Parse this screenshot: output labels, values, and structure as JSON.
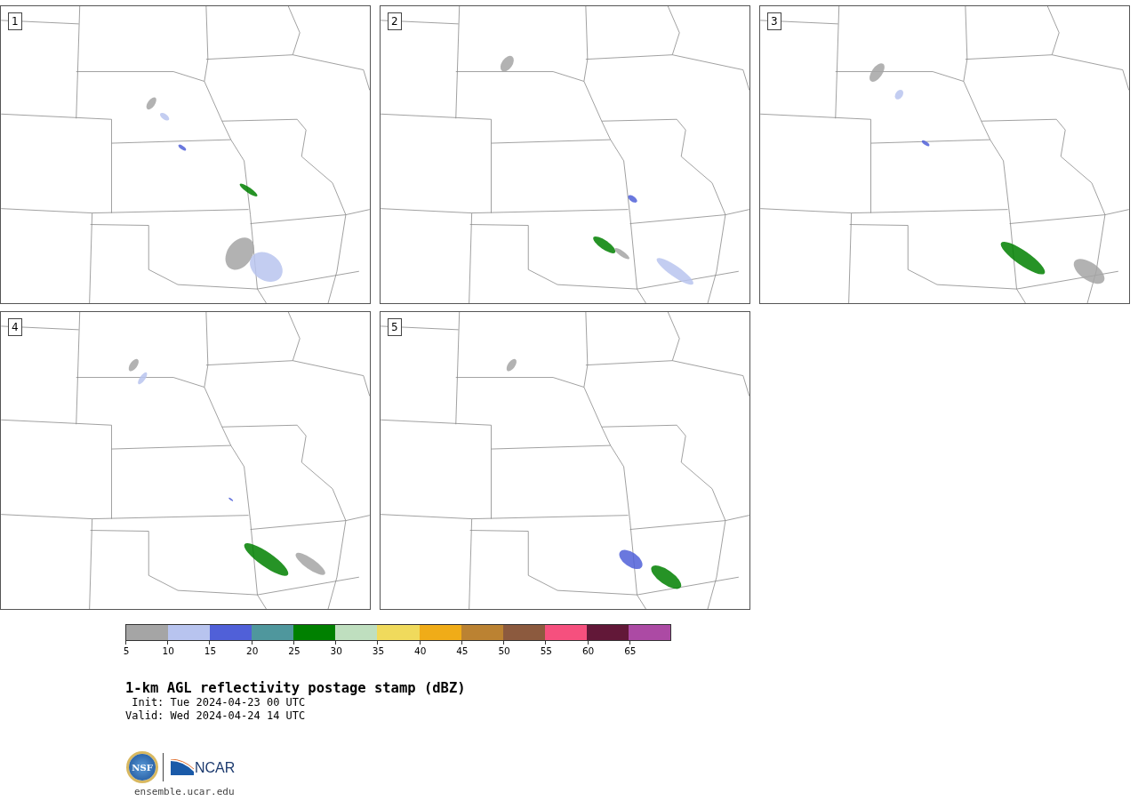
{
  "panels": [
    {
      "label": "1"
    },
    {
      "label": "2"
    },
    {
      "label": "3"
    },
    {
      "label": "4"
    },
    {
      "label": "5"
    }
  ],
  "colorbar": {
    "segments": [
      {
        "color": "#a5a5a5"
      },
      {
        "color": "#b8c4ef"
      },
      {
        "color": "#5060d8"
      },
      {
        "color": "#4f979d"
      },
      {
        "color": "#008000"
      },
      {
        "color": "#bfdfbf"
      },
      {
        "color": "#f0da5c"
      },
      {
        "color": "#f0ac18"
      },
      {
        "color": "#bb8232"
      },
      {
        "color": "#8c5a3e"
      },
      {
        "color": "#f6507e"
      },
      {
        "color": "#621838"
      },
      {
        "color": "#ac4aa4"
      }
    ],
    "ticks": [
      "5",
      "10",
      "15",
      "20",
      "25",
      "30",
      "35",
      "40",
      "45",
      "50",
      "55",
      "60",
      "65"
    ]
  },
  "title": "1-km AGL reflectivity postage stamp (dBZ)",
  "init": " Init: Tue 2024-04-23 00 UTC",
  "valid": "Valid: Wed 2024-04-24 14 UTC",
  "logo": {
    "nsf": "NSF",
    "ncar": "NCAR"
  },
  "url": "ensemble.ucar.edu"
}
